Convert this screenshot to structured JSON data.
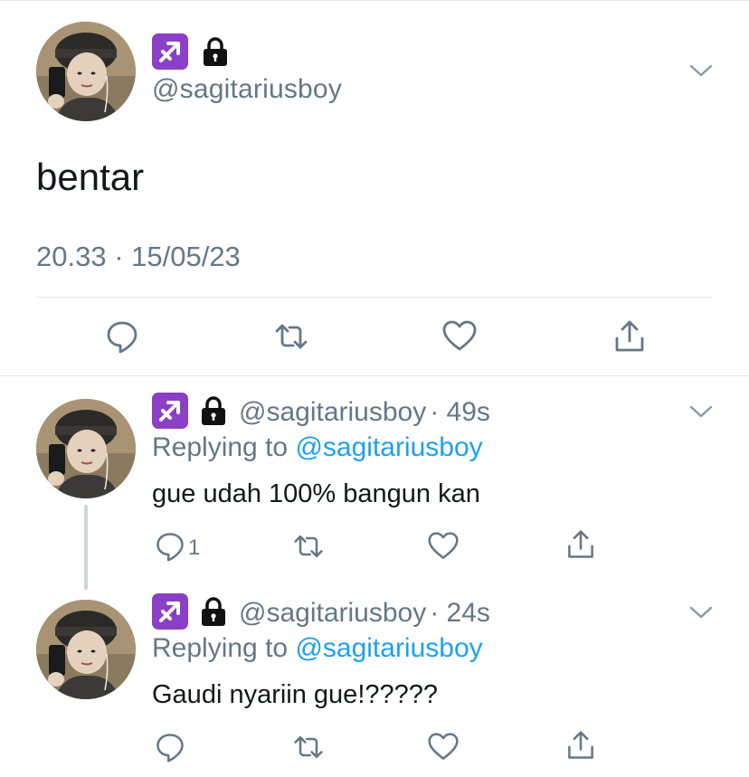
{
  "main_tweet": {
    "emoji_1": "sagittarius-icon",
    "emoji_2": "lock-icon",
    "handle": "@sagitariusboy",
    "text": "bentar",
    "timestamp": "20.33 · 15/05/23"
  },
  "replies": [
    {
      "handle": "@sagitariusboy",
      "time": "· 49s",
      "replying_label": "Replying to",
      "replying_to": "@sagitariusboy",
      "text": "gue udah 100% bangun kan",
      "reply_count": "1"
    },
    {
      "handle": "@sagitariusboy",
      "time": "· 24s",
      "replying_label": "Replying to",
      "replying_to": "@sagitariusboy",
      "text": "Gaudi nyariin gue!?????",
      "reply_count": ""
    }
  ],
  "colors": {
    "text": "#14171a",
    "secondary": "#657786",
    "link": "#1da1f2",
    "divider": "#e1e8ed",
    "sagittarius_bg": "#8a3fc7"
  }
}
